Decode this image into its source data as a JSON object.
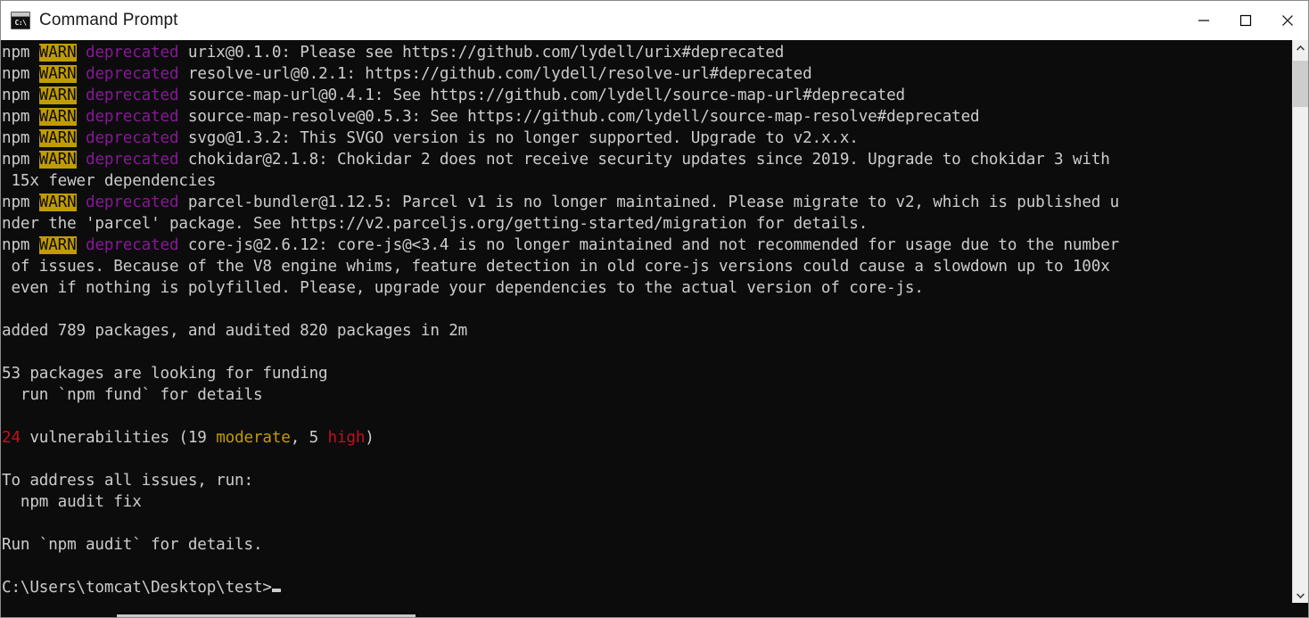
{
  "window": {
    "title": "Command Prompt",
    "icon": "command-prompt-icon",
    "icon_label": "C:\\",
    "controls": {
      "minimize": "Minimize",
      "maximize": "Maximize",
      "close": "Close"
    }
  },
  "colors": {
    "background": "#0c0c0c",
    "foreground": "#cccccc",
    "magenta": "#881798",
    "red": "#c50f1f",
    "yellow": "#c19c00",
    "warn_bg": "#c19c00",
    "warn_fg": "#0c0c0c",
    "titlebar_bg": "#ffffff",
    "titlebar_fg": "#1a1a1a"
  },
  "terminal": {
    "prompt": "C:\\Users\\tomcat\\Desktop\\test>",
    "cursor": "block",
    "lines": [
      {
        "id": "warn-urix",
        "segments": [
          {
            "text": "npm ",
            "style": "white"
          },
          {
            "text": "WARN",
            "style": "warn"
          },
          {
            "text": " ",
            "style": "white"
          },
          {
            "text": "deprecated",
            "style": "magenta"
          },
          {
            "text": " urix@0.1.0: Please see https://github.com/lydell/urix#deprecated",
            "style": "white"
          }
        ]
      },
      {
        "id": "warn-resolve-url",
        "segments": [
          {
            "text": "npm ",
            "style": "white"
          },
          {
            "text": "WARN",
            "style": "warn"
          },
          {
            "text": " ",
            "style": "white"
          },
          {
            "text": "deprecated",
            "style": "magenta"
          },
          {
            "text": " resolve-url@0.2.1: https://github.com/lydell/resolve-url#deprecated",
            "style": "white"
          }
        ]
      },
      {
        "id": "warn-source-map-url",
        "segments": [
          {
            "text": "npm ",
            "style": "white"
          },
          {
            "text": "WARN",
            "style": "warn"
          },
          {
            "text": " ",
            "style": "white"
          },
          {
            "text": "deprecated",
            "style": "magenta"
          },
          {
            "text": " source-map-url@0.4.1: See https://github.com/lydell/source-map-url#deprecated",
            "style": "white"
          }
        ]
      },
      {
        "id": "warn-source-map-resolve",
        "segments": [
          {
            "text": "npm ",
            "style": "white"
          },
          {
            "text": "WARN",
            "style": "warn"
          },
          {
            "text": " ",
            "style": "white"
          },
          {
            "text": "deprecated",
            "style": "magenta"
          },
          {
            "text": " source-map-resolve@0.5.3: See https://github.com/lydell/source-map-resolve#deprecated",
            "style": "white"
          }
        ]
      },
      {
        "id": "warn-svgo",
        "segments": [
          {
            "text": "npm ",
            "style": "white"
          },
          {
            "text": "WARN",
            "style": "warn"
          },
          {
            "text": " ",
            "style": "white"
          },
          {
            "text": "deprecated",
            "style": "magenta"
          },
          {
            "text": " svgo@1.3.2: This SVGO version is no longer supported. Upgrade to v2.x.x.",
            "style": "white"
          }
        ]
      },
      {
        "id": "warn-chokidar",
        "segments": [
          {
            "text": "npm ",
            "style": "white"
          },
          {
            "text": "WARN",
            "style": "warn"
          },
          {
            "text": " ",
            "style": "white"
          },
          {
            "text": "deprecated",
            "style": "magenta"
          },
          {
            "text": " chokidar@2.1.8: Chokidar 2 does not receive security updates since 2019. Upgrade to chokidar 3 with",
            "style": "white"
          }
        ]
      },
      {
        "id": "warn-chokidar-wrap",
        "segments": [
          {
            "text": " 15x fewer dependencies",
            "style": "white"
          }
        ]
      },
      {
        "id": "warn-parcel",
        "segments": [
          {
            "text": "npm ",
            "style": "white"
          },
          {
            "text": "WARN",
            "style": "warn"
          },
          {
            "text": " ",
            "style": "white"
          },
          {
            "text": "deprecated",
            "style": "magenta"
          },
          {
            "text": " parcel-bundler@1.12.5: Parcel v1 is no longer maintained. Please migrate to v2, which is published u",
            "style": "white"
          }
        ]
      },
      {
        "id": "warn-parcel-wrap",
        "segments": [
          {
            "text": "nder the 'parcel' package. See https://v2.parceljs.org/getting-started/migration for details.",
            "style": "white"
          }
        ]
      },
      {
        "id": "warn-corejs",
        "segments": [
          {
            "text": "npm ",
            "style": "white"
          },
          {
            "text": "WARN",
            "style": "warn"
          },
          {
            "text": " ",
            "style": "white"
          },
          {
            "text": "deprecated",
            "style": "magenta"
          },
          {
            "text": " core-js@2.6.12: core-js@<3.4 is no longer maintained and not recommended for usage due to the number",
            "style": "white"
          }
        ]
      },
      {
        "id": "warn-corejs-wrap1",
        "segments": [
          {
            "text": " of issues. Because of the V8 engine whims, feature detection in old core-js versions could cause a slowdown up to 100x",
            "style": "white"
          }
        ]
      },
      {
        "id": "warn-corejs-wrap2",
        "segments": [
          {
            "text": " even if nothing is polyfilled. Please, upgrade your dependencies to the actual version of core-js.",
            "style": "white"
          }
        ]
      },
      {
        "id": "blank-1",
        "segments": [
          {
            "text": "",
            "style": "white"
          }
        ]
      },
      {
        "id": "added-packages",
        "segments": [
          {
            "text": "added 789 packages, and audited 820 packages in 2m",
            "style": "white"
          }
        ]
      },
      {
        "id": "blank-2",
        "segments": [
          {
            "text": "",
            "style": "white"
          }
        ]
      },
      {
        "id": "funding-count",
        "segments": [
          {
            "text": "53 packages are looking for funding",
            "style": "white"
          }
        ]
      },
      {
        "id": "funding-run",
        "segments": [
          {
            "text": "  run `npm fund` for details",
            "style": "white"
          }
        ]
      },
      {
        "id": "blank-3",
        "segments": [
          {
            "text": "",
            "style": "white"
          }
        ]
      },
      {
        "id": "vulnerabilities",
        "segments": [
          {
            "text": "24",
            "style": "red"
          },
          {
            "text": " vulnerabilities (19 ",
            "style": "white"
          },
          {
            "text": "moderate",
            "style": "yellow"
          },
          {
            "text": ", 5 ",
            "style": "white"
          },
          {
            "text": "high",
            "style": "red"
          },
          {
            "text": ")",
            "style": "white"
          }
        ]
      },
      {
        "id": "blank-4",
        "segments": [
          {
            "text": "",
            "style": "white"
          }
        ]
      },
      {
        "id": "address-issues",
        "segments": [
          {
            "text": "To address all issues, run:",
            "style": "white"
          }
        ]
      },
      {
        "id": "audit-fix",
        "segments": [
          {
            "text": "  npm audit fix",
            "style": "white"
          }
        ]
      },
      {
        "id": "blank-5",
        "segments": [
          {
            "text": "",
            "style": "white"
          }
        ]
      },
      {
        "id": "run-audit",
        "segments": [
          {
            "text": "Run `npm audit` for details.",
            "style": "white"
          }
        ]
      },
      {
        "id": "blank-6",
        "segments": [
          {
            "text": "",
            "style": "white"
          }
        ]
      }
    ]
  },
  "scrollbars": {
    "vertical": {
      "up_arrow": "scroll-up-icon",
      "down_arrow": "scroll-down-icon"
    },
    "horizontal": {
      "present": true
    }
  }
}
